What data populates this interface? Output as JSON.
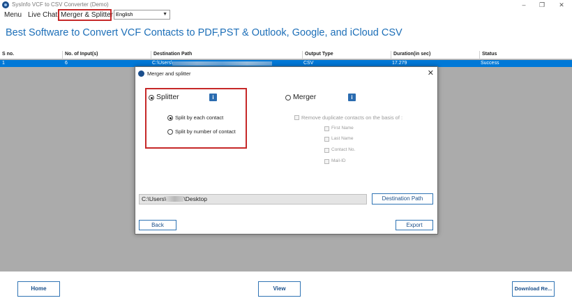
{
  "window": {
    "title": "SysInfo VCF to CSV Converter (Demo)",
    "controls": {
      "minimize": "–",
      "maximize": "❐",
      "close": "✕"
    }
  },
  "menu": {
    "items": [
      "Menu",
      "Live Chat",
      "Merger & Splitter"
    ],
    "language": "English"
  },
  "headline": "Best Software to Convert VCF Contacts to PDF,PST & Outlook, Google, and iCloud CSV",
  "table": {
    "headers": [
      "S no.",
      "No. of Input(s)",
      "Destination Path",
      "Output Type",
      "Duration(in sec)",
      "Status"
    ],
    "rows": [
      {
        "sno": "1",
        "inputs": "6",
        "path": "C:\\Users\\",
        "output": "CSV",
        "duration": "17.279",
        "status": "Success"
      }
    ]
  },
  "dialog": {
    "title": "Merger and splitter",
    "close": "✕",
    "splitter": {
      "label": "Splitter",
      "options": [
        "Split by each contact",
        "Split by number of contact"
      ]
    },
    "merger": {
      "label": "Merger",
      "remove_duplicates": "Remove duplicate contacts on the basis of :",
      "fields": [
        "First Name",
        "Last Name",
        "Contact No.",
        "Mail-ID"
      ]
    },
    "info_glyph": "i",
    "path_prefix": "C:\\Users\\",
    "path_suffix": "\\Desktop",
    "destination_button": "Destination Path",
    "back_button": "Back",
    "export_button": "Export"
  },
  "footer": {
    "home": "Home",
    "view": "View",
    "download": "Download Re..."
  },
  "colors": {
    "accent": "#1d6fb8",
    "selection": "#0078d7",
    "highlight_border": "#c62828",
    "grid_background": "#ababab"
  }
}
